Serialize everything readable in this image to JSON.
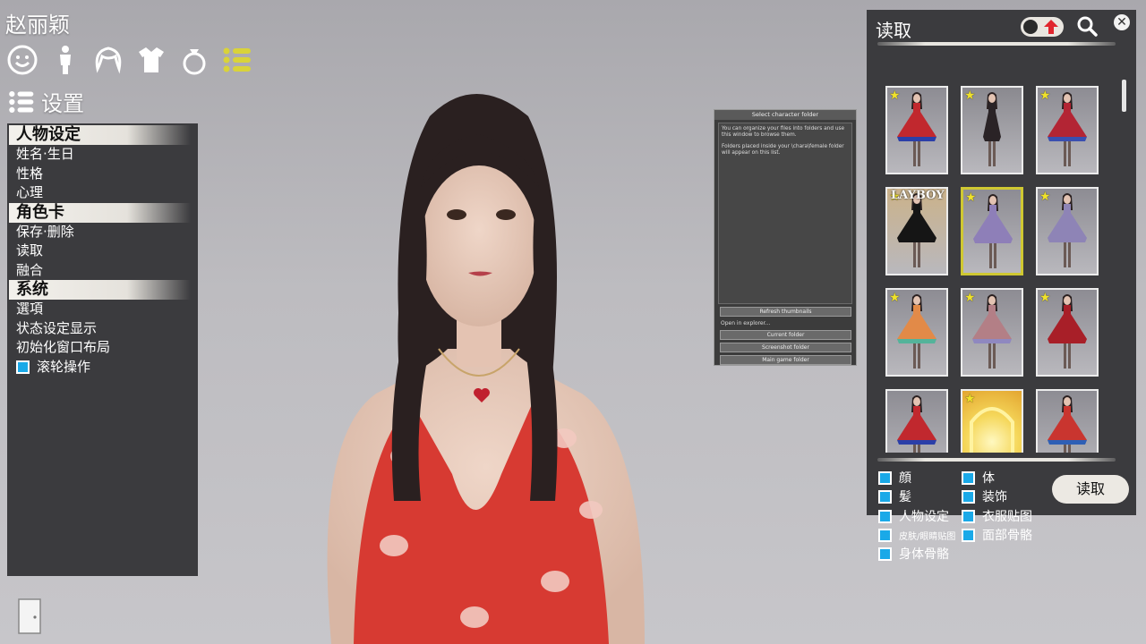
{
  "character_name": "赵丽颖",
  "categories": [
    "face-icon",
    "body-icon",
    "hair-icon",
    "clothing-icon",
    "accessory-icon",
    "system-list-icon"
  ],
  "settings_header": "设置",
  "menu": {
    "sections": [
      {
        "title": "人物设定",
        "items": [
          "姓名·生日",
          "性格",
          "心理"
        ]
      },
      {
        "title": "角色卡",
        "items": [
          "保存·删除",
          "读取",
          "融合"
        ]
      },
      {
        "title": "系统",
        "items": [
          "選項",
          "状态设定显示",
          "初始化窗口布局"
        ]
      }
    ],
    "wheel_label": "滚轮操作"
  },
  "folder_dialog": {
    "title": "Select character folder",
    "text1": "You can organize your files into folders and use this window to browse them.",
    "text2": "Folders placed inside your \\chara\\female folder will appear on this list.",
    "refresh": "Refresh thumbnails",
    "open_label": "Open in explorer...",
    "current": "Current folder",
    "screenshot": "Screenshot folder",
    "main": "Main game folder"
  },
  "load_panel": {
    "title": "读取",
    "load_button": "读取",
    "options_left": [
      {
        "label": "顔"
      },
      {
        "label": "髪"
      },
      {
        "label": "人物设定"
      },
      {
        "label": "皮肤/眼睛贴图",
        "small": true
      },
      {
        "label": "身体骨骼"
      }
    ],
    "options_right": [
      {
        "label": "体"
      },
      {
        "label": "装饰"
      },
      {
        "label": "衣服贴图"
      },
      {
        "label": "面部骨骼"
      }
    ],
    "colors": {
      "panel": "#3b3b3e",
      "checkbox": "#1aa9e8",
      "selected_border": "#cfc832"
    },
    "cards": [
      {
        "bg": "#8d8c93",
        "dress": "#c1282e",
        "hem": "#2b3fa8",
        "star": true
      },
      {
        "bg": "#8a898f",
        "dress": "#2a2326",
        "hem": "#2a2326",
        "star": true,
        "slim": true
      },
      {
        "bg": "#8d8c93",
        "dress": "#b32534",
        "hem": "#3a4fb0",
        "star": true
      },
      {
        "bg": "#cbb28a",
        "dress": "#151515",
        "hem": "#151515",
        "star": true,
        "magazine": "LAYBOY"
      },
      {
        "bg": "#8d8c93",
        "dress": "#8e7fb8",
        "hem": "#8e7fb8",
        "star": true,
        "selected": true
      },
      {
        "bg": "#8d8c93",
        "dress": "#8e84b6",
        "hem": "#8e84b6",
        "star": true
      },
      {
        "bg": "#8d8c93",
        "dress": "#e28a48",
        "hem": "#54b39a",
        "star": true
      },
      {
        "bg": "#8d8c93",
        "dress": "#b37f86",
        "hem": "#8f88c0",
        "star": true
      },
      {
        "bg": "#8d8c93",
        "dress": "#a81f28",
        "hem": "#a81f28",
        "star": true
      },
      {
        "bg": "#8d8c93",
        "dress": "#c1282e",
        "hem": "#2b3fa8",
        "star": false
      },
      {
        "bg": "#e6b338",
        "dress": "#fff7a8",
        "hem": "#fff7a8",
        "star": true,
        "glow": true
      },
      {
        "bg": "#8d8c93",
        "dress": "#c9352f",
        "hem": "#2e5fb5",
        "star": false
      }
    ]
  }
}
